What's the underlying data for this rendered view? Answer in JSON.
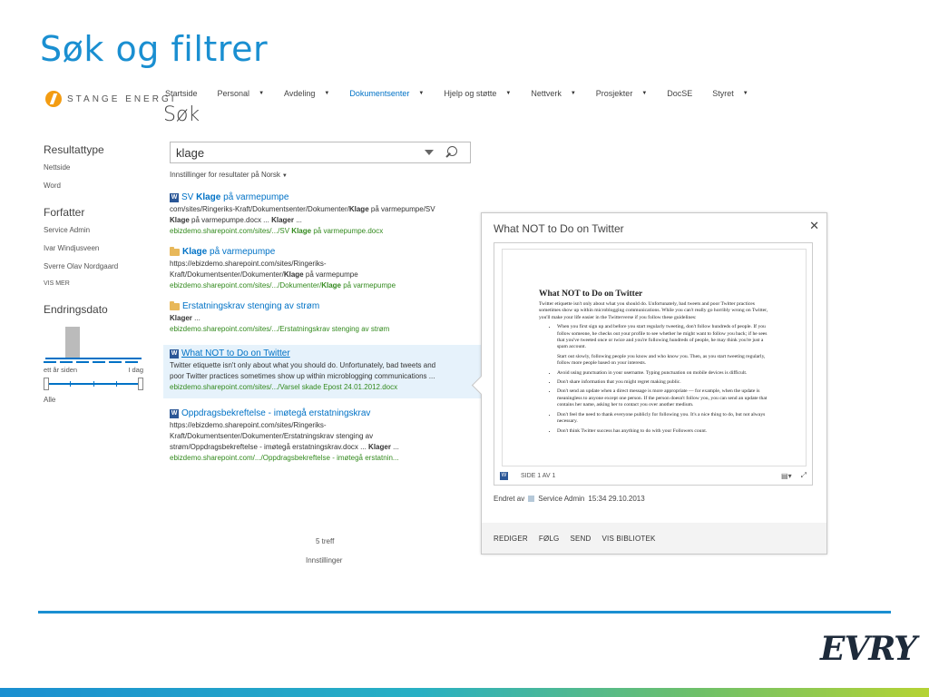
{
  "slide": {
    "title": "Søk og filtrer",
    "brand": "EVRY"
  },
  "logo": {
    "text": "STANGE ENERGI"
  },
  "topnav": [
    {
      "label": "Startside",
      "dropdown": false,
      "active": false
    },
    {
      "label": "Personal",
      "dropdown": true,
      "active": false
    },
    {
      "label": "Avdeling",
      "dropdown": true,
      "active": false
    },
    {
      "label": "Dokumentsenter",
      "dropdown": true,
      "active": true
    },
    {
      "label": "Hjelp og støtte",
      "dropdown": true,
      "active": false
    },
    {
      "label": "Nettverk",
      "dropdown": true,
      "active": false
    },
    {
      "label": "Prosjekter",
      "dropdown": true,
      "active": false
    },
    {
      "label": "DocSE",
      "dropdown": false,
      "active": false
    },
    {
      "label": "Styret",
      "dropdown": true,
      "active": false
    }
  ],
  "page_heading": "Søk",
  "search": {
    "value": "klage"
  },
  "preferences": {
    "label": "Innstillinger for resultater på Norsk"
  },
  "refiners": {
    "result_type": {
      "title": "Resultattype",
      "items": [
        "Nettside",
        "Word"
      ]
    },
    "author": {
      "title": "Forfatter",
      "items": [
        "Service Admin",
        "Ivar Windjusveen",
        "Sverre Olav Nordgaard"
      ],
      "more": "VIS MER"
    },
    "modified": {
      "title": "Endringsdato",
      "left": "ett år siden",
      "right": "I dag",
      "value": "Alle"
    }
  },
  "results": [
    {
      "icon": "word-doc-icon",
      "title_pre": "SV ",
      "title_hl": "Klage",
      "title_post": " på varmepumpe",
      "lines": [
        [
          {
            "t": "com/sites/Ringeriks-Kraft/Dokumentsenter/Dokumenter/",
            "b": false
          },
          {
            "t": "Klage",
            "b": true
          },
          {
            "t": " på varmepumpe/SV",
            "b": false
          }
        ],
        [
          {
            "t": "Klage",
            "b": true
          },
          {
            "t": " på varmepumpe.docx ... ",
            "b": false
          },
          {
            "t": "Klager",
            "b": true
          },
          {
            "t": " ...",
            "b": false
          }
        ]
      ],
      "url": [
        {
          "t": "ebizdemo.sharepoint.com/sites/.../SV ",
          "b": false
        },
        {
          "t": "Klage",
          "b": true
        },
        {
          "t": " på varmepumpe.docx",
          "b": false
        }
      ]
    },
    {
      "icon": "folder-icon",
      "title_pre": "",
      "title_hl": "Klage",
      "title_post": " på varmepumpe",
      "lines": [
        [
          {
            "t": "https://ebizdemo.sharepoint.com/sites/Ringeriks-",
            "b": false
          }
        ],
        [
          {
            "t": "Kraft/Dokumentsenter/Dokumenter/",
            "b": false
          },
          {
            "t": "Klage",
            "b": true
          },
          {
            "t": " på varmepumpe",
            "b": false
          }
        ]
      ],
      "url": [
        {
          "t": "ebizdemo.sharepoint.com/sites/.../Dokumenter/",
          "b": false
        },
        {
          "t": "Klage",
          "b": true
        },
        {
          "t": " på varmepumpe",
          "b": false
        }
      ]
    },
    {
      "icon": "folder-icon",
      "title_pre": "Erstatningskrav stenging av strøm",
      "title_hl": "",
      "title_post": "",
      "lines": [
        [
          {
            "t": "Klager",
            "b": true
          },
          {
            "t": " ...",
            "b": false
          }
        ]
      ],
      "url": [
        {
          "t": "ebizdemo.sharepoint.com/sites/.../Erstatningskrav stenging av strøm",
          "b": false
        }
      ]
    },
    {
      "icon": "word-doc-icon",
      "hovered": true,
      "title_pre": "What NOT to Do on Twitter",
      "title_hl": "",
      "title_post": "",
      "lines": [
        [
          {
            "t": "Twitter etiquette isn't only about what you should do. Unfortunately, bad tweets and",
            "b": false
          }
        ],
        [
          {
            "t": "poor Twitter practices sometimes show up within microblogging communications ...",
            "b": false
          }
        ]
      ],
      "url": [
        {
          "t": "ebizdemo.sharepoint.com/sites/.../Varsel skade Epost 24.01.2012.docx",
          "b": false
        }
      ]
    },
    {
      "icon": "word-doc-icon",
      "title_pre": "Oppdragsbekreftelse - imøtegå erstatningskrav",
      "title_hl": "",
      "title_post": "",
      "lines": [
        [
          {
            "t": "https://ebizdemo.sharepoint.com/sites/Ringeriks-",
            "b": false
          }
        ],
        [
          {
            "t": "Kraft/Dokumentsenter/Dokumenter/Erstatningskrav stenging av",
            "b": false
          }
        ],
        [
          {
            "t": "strøm/Oppdragsbekreftelse - imøtegå erstatningskrav.docx ... ",
            "b": false
          },
          {
            "t": "Klager",
            "b": true
          },
          {
            "t": " ...",
            "b": false
          }
        ]
      ],
      "url": [
        {
          "t": "ebizdemo.sharepoint.com/.../Oppdragsbekreftelse - imøtegå erstatnin...",
          "b": false
        }
      ]
    }
  ],
  "footer": {
    "count": "5 treff",
    "settings": "Innstillinger"
  },
  "hovercard": {
    "title": "What NOT to Do on Twitter",
    "doc": {
      "heading": "What NOT to Do on Twitter",
      "intro": "Twitter etiquette isn't only about what you should do. Unfortunately, bad tweets and poor Twitter practices sometimes show up within microblogging communications. While you can't really go horribly wrong on Twitter, you'll make your life easier in the Twitterverse if you follow these guidelines:",
      "bullets": [
        "When you first sign up and before you start regularly tweeting, don't follow hundreds of people. If you follow someone, he checks out your profile to see whether he might want to follow you back; if he sees that you've tweeted once or twice and you're following hundreds of people, he may think you're just a spam account.",
        "Avoid using punctuation in your username. Typing punctuation on mobile devices is difficult.",
        "Don't share information that you might regret making public.",
        "Don't send an update when a direct message is more appropriate — for example, when the update is meaningless to anyone except one person. If the person doesn't follow you, you can send an update that contains her name, asking her to contact you over another medium.",
        "Don't feel the need to thank everyone publicly for following you. It's a nice thing to do, but not always necessary.",
        "Don't think Twitter success has anything to do with your Followers count."
      ],
      "sub_para": "Start out slowly, following people you know and who know you. Then, as you start tweeting regularly, follow more people based on your interests."
    },
    "viewer": {
      "page": "SIDE 1 AV 1"
    },
    "meta": {
      "label": "Endret av",
      "person": "Service Admin",
      "timestamp": "15:34 29.10.2013"
    },
    "actions": [
      "REDIGER",
      "FØLG",
      "SEND",
      "VIS BIBLIOTEK"
    ]
  }
}
